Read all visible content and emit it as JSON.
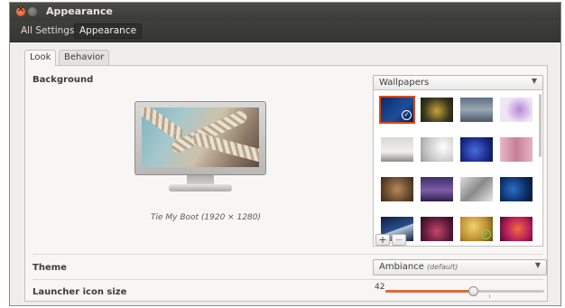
{
  "window": {
    "title": "Appearance"
  },
  "toolbar": {
    "crumbs": [
      "All Settings",
      "Appearance"
    ]
  },
  "tabs": [
    {
      "label": "Look",
      "active": true
    },
    {
      "label": "Behavior",
      "active": false
    }
  ],
  "background": {
    "label": "Background",
    "dropdown_value": "Wallpapers",
    "caption": "Tie My Boot (1920 × 1280)",
    "add_label": "+",
    "remove_label": "−"
  },
  "theme": {
    "label": "Theme",
    "value": "Ambiance",
    "hint": "(default)"
  },
  "launcher": {
    "label": "Launcher icon size",
    "value": "42",
    "level": 0.55
  },
  "colors": {
    "accent": "#dd4814",
    "titlebar": "#3c3b37",
    "window_bg": "#efeeec",
    "slider_fill": "#dd6a3b"
  }
}
